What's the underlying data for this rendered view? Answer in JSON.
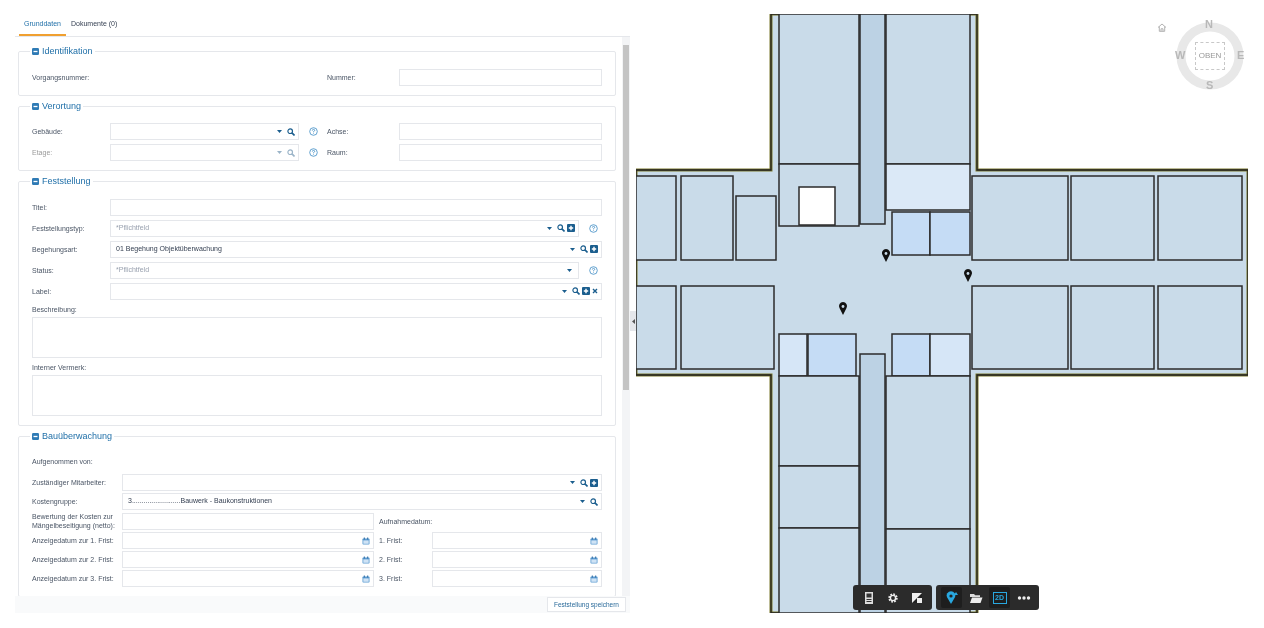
{
  "tabs": [
    {
      "label": "Grunddaten",
      "selected": true
    },
    {
      "label": "Dokumente (0)",
      "selected": false
    }
  ],
  "sections": [
    {
      "title": "Identifikation",
      "expanded": true,
      "rows": [
        {
          "kind": "split",
          "left": {
            "label": "Vorgangsnummer:"
          },
          "right": {
            "label": "Nummer:",
            "control": {
              "kind": "input"
            }
          }
        }
      ]
    },
    {
      "title": "Verortung",
      "expanded": true,
      "rows": [
        {
          "kind": "split",
          "left": {
            "label": "Gebäude:",
            "disabled": false,
            "control": {
              "kind": "select",
              "search": true,
              "help": true
            }
          },
          "right": {
            "label": "Achse:",
            "control": {
              "kind": "input"
            }
          }
        },
        {
          "kind": "split",
          "left": {
            "label": "Etage:",
            "disabled": true,
            "control": {
              "kind": "select",
              "search": true,
              "help": true
            }
          },
          "right": {
            "label": "Raum:",
            "control": {
              "kind": "input"
            }
          }
        }
      ]
    },
    {
      "title": "Feststellung",
      "expanded": true,
      "rows": [
        {
          "kind": "full",
          "label": "Titel:",
          "control": {
            "kind": "input"
          }
        },
        {
          "kind": "full",
          "label": "Feststellungstyp:",
          "control": {
            "kind": "select",
            "placeholder": "*Pflichtfeld",
            "search": true,
            "add": true,
            "help": true
          }
        },
        {
          "kind": "full",
          "label": "Begehungsart:",
          "control": {
            "kind": "select",
            "value": "01 Begehung Objektüberwachung",
            "search": true,
            "add": true
          }
        },
        {
          "kind": "full",
          "label": "Status:",
          "control": {
            "kind": "select",
            "placeholder": "*Pflichtfeld",
            "help": true
          }
        },
        {
          "kind": "full",
          "label": "Label:",
          "control": {
            "kind": "select",
            "search": true,
            "add": true,
            "clear": true
          }
        },
        {
          "kind": "textarea",
          "label": "Beschreibung:"
        },
        {
          "kind": "textarea",
          "label": "Interner Vermerk:"
        }
      ]
    },
    {
      "title": "Bauüberwachung",
      "expanded": true,
      "rows": [
        {
          "kind": "text",
          "label": "Aufgenommen von:"
        },
        {
          "kind": "full",
          "label": "Zuständiger Mitarbeiter:",
          "control": {
            "kind": "select",
            "search": true,
            "add": true
          }
        },
        {
          "kind": "full",
          "label": "Kostengruppe:",
          "control": {
            "kind": "select",
            "value": "3.........................Bauwerk - Baukonstruktionen",
            "search": true
          }
        },
        {
          "kind": "split",
          "left": {
            "label": "Bewertung der Kosten zur Mängelbeseitigung (netto):",
            "control": {
              "kind": "input"
            }
          },
          "right": {
            "label": "Aufnahmedatum:"
          }
        },
        {
          "kind": "split",
          "left": {
            "label": "Anzeigedatum zur 1. Frist:",
            "control": {
              "kind": "date"
            }
          },
          "right": {
            "label": "1. Frist:",
            "control": {
              "kind": "date"
            }
          }
        },
        {
          "kind": "split",
          "left": {
            "label": "Anzeigedatum zur 2. Frist:",
            "control": {
              "kind": "date"
            }
          },
          "right": {
            "label": "2. Frist:",
            "control": {
              "kind": "date"
            }
          }
        },
        {
          "kind": "split",
          "left": {
            "label": "Anzeigedatum zur 3. Frist:",
            "control": {
              "kind": "date"
            }
          },
          "right": {
            "label": "3. Frist:",
            "control": {
              "kind": "date"
            }
          }
        }
      ]
    }
  ],
  "save_button": "Feststellung speichern",
  "compass": {
    "north": "N",
    "east": "E",
    "south": "S",
    "west": "W",
    "center": "OBEN"
  },
  "toolbar": [
    [
      {
        "kind": "layout",
        "selected": false
      },
      {
        "kind": "settings",
        "selected": false
      },
      {
        "kind": "contrast",
        "selected": false
      }
    ],
    [
      {
        "kind": "marker",
        "selected": true
      },
      {
        "kind": "folder",
        "selected": false
      },
      {
        "kind": "view",
        "label": "2D",
        "selected": true
      },
      {
        "kind": "more",
        "selected": false
      }
    ]
  ]
}
